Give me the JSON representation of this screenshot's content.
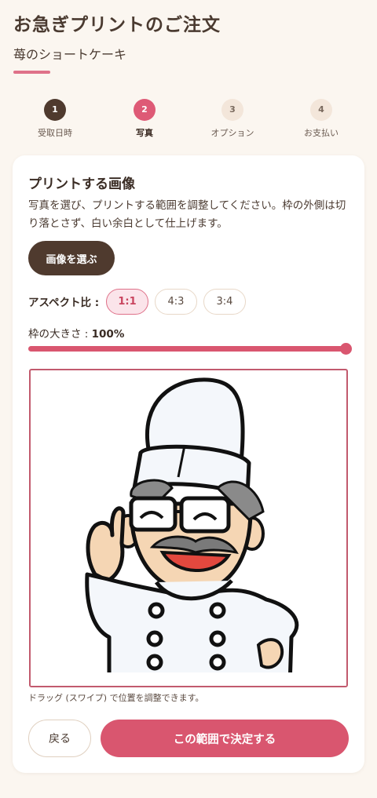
{
  "header": {
    "title": "お急ぎプリントのご注文",
    "product": "苺のショートケーキ"
  },
  "steps": [
    {
      "number": "1",
      "label": "受取日時",
      "state": "done"
    },
    {
      "number": "2",
      "label": "写真",
      "state": "active"
    },
    {
      "number": "3",
      "label": "オプション",
      "state": "todo"
    },
    {
      "number": "4",
      "label": "お支払い",
      "state": "todo"
    }
  ],
  "editor": {
    "title": "プリントする画像",
    "description": "写真を選び、プリントする範囲を調整してください。枠の外側は切り落とさず、白い余白として仕上げます。",
    "choose_button": "画像を選ぶ",
    "aspect_label": "アスペクト比 :",
    "aspect_options": [
      "1:1",
      "4:3",
      "3:4"
    ],
    "aspect_selected": "1:1",
    "frame_size_label": "枠の大きさ : ",
    "frame_size_value": "100%",
    "frame_size_fraction": 1.0,
    "hint": "ドラッグ (スワイプ) で位置を調整できます。",
    "back_button": "戻る",
    "confirm_button": "この範囲で決定する"
  },
  "colors": {
    "accent": "#d9566f",
    "dark": "#4f3a2e",
    "background": "#fbf6f0"
  }
}
